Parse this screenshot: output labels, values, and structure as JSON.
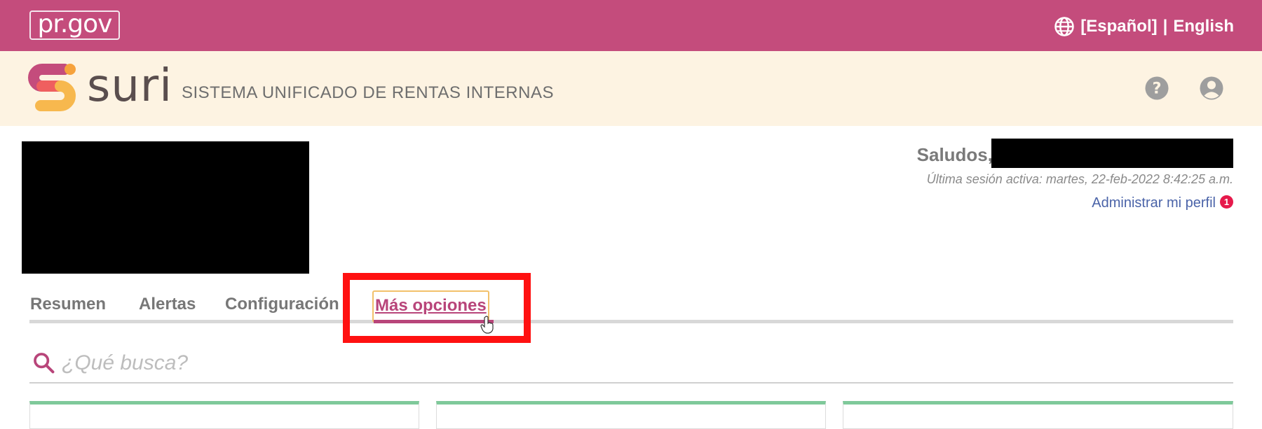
{
  "topbar": {
    "logo_text": "pr.gov",
    "language_selected": "[Español]",
    "language_separator": "|",
    "language_other": "English",
    "background_color": "#c44c7c"
  },
  "app": {
    "brand_word": "suri",
    "subtitle": "SISTEMA UNIFICADO DE RENTAS INTERNAS",
    "background_color": "#fdf3e2",
    "icons": [
      "help-icon",
      "account-icon"
    ]
  },
  "user": {
    "greeting": "Saludos,",
    "last_session": "Última sesión activa: martes, 22-feb-2022 8:42:25 a.m.",
    "profile_link": "Administrar mi perfil",
    "profile_badge_count": "1"
  },
  "tabs": [
    {
      "label": "Resumen",
      "active": false
    },
    {
      "label": "Alertas",
      "active": false
    },
    {
      "label": "Configuración",
      "active": false
    },
    {
      "label": "Más opciones",
      "active": true
    }
  ],
  "search": {
    "placeholder": "¿Qué busca?",
    "value": ""
  },
  "colors": {
    "accent": "#b8457a",
    "highlight": "#ff1111",
    "card_top": "#7fc99a"
  }
}
